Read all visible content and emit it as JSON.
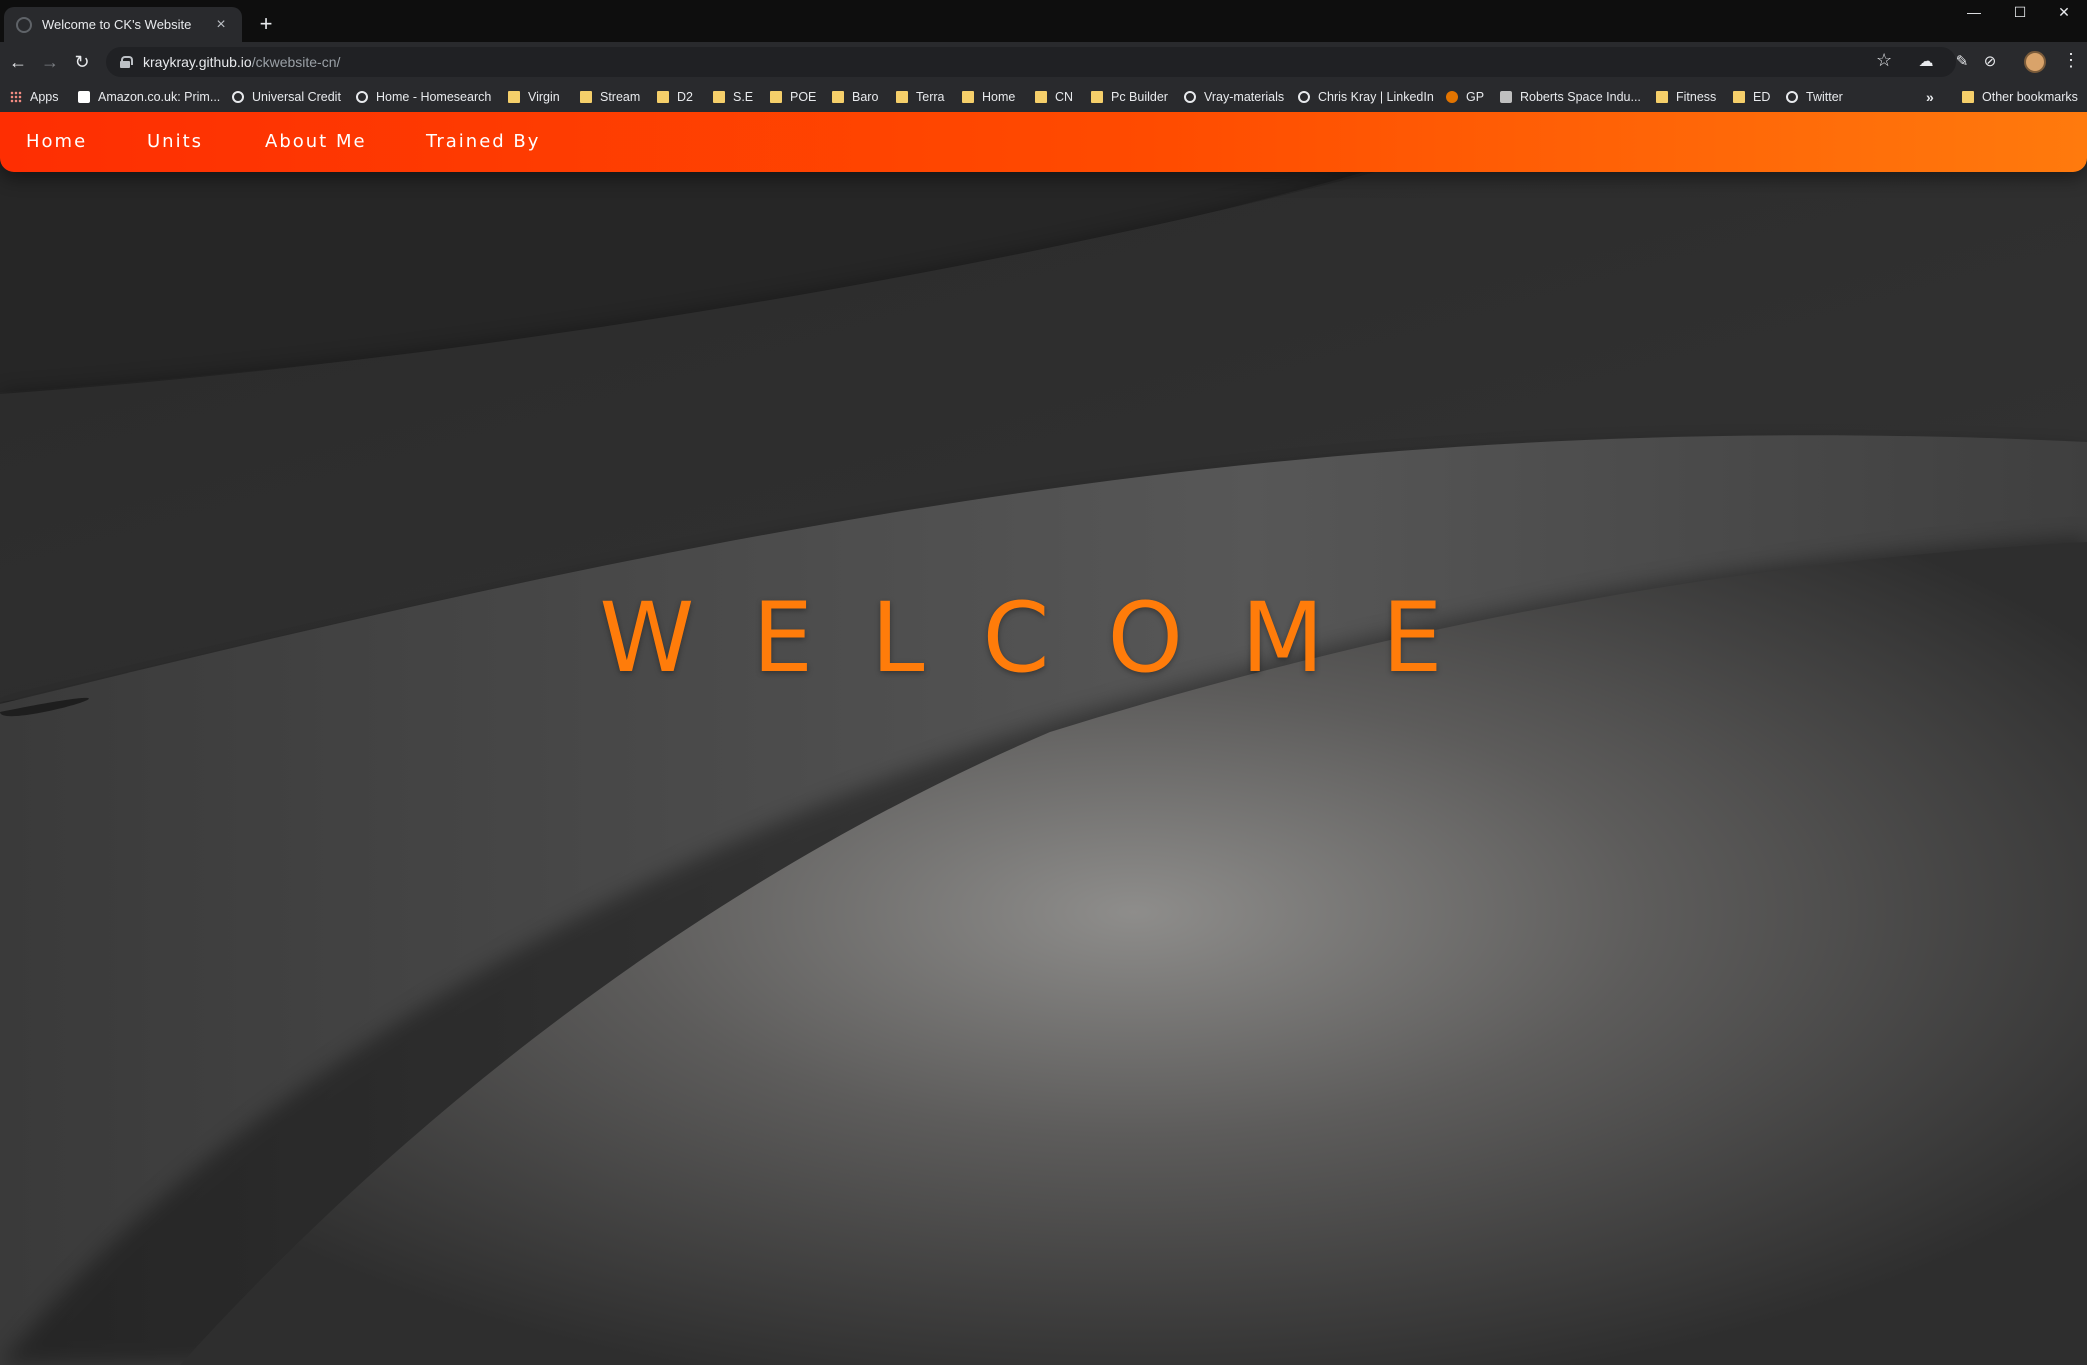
{
  "browser": {
    "tab": {
      "title": "Welcome to CK's Website"
    },
    "new_tab_symbol": "+",
    "window_controls": [
      "—",
      "☐",
      "✕"
    ],
    "url_host": "kraykray.github.io",
    "url_path": "/ckwebsite-cn/",
    "bookmarks": [
      {
        "label": "Apps",
        "icon": "apps-icon"
      },
      {
        "label": "Amazon.co.uk: Prim...",
        "icon": "amazon-icon"
      },
      {
        "label": "Universal Credit",
        "icon": "globe-icon"
      },
      {
        "label": "Home - Homesearch",
        "icon": "globe-icon"
      },
      {
        "label": "Virgin",
        "icon": "folder-icon"
      },
      {
        "label": "Stream",
        "icon": "folder-icon"
      },
      {
        "label": "D2",
        "icon": "folder-icon"
      },
      {
        "label": "S.E",
        "icon": "folder-icon"
      },
      {
        "label": "POE",
        "icon": "folder-icon"
      },
      {
        "label": "Baro",
        "icon": "folder-icon"
      },
      {
        "label": "Terra",
        "icon": "folder-icon"
      },
      {
        "label": "Home",
        "icon": "folder-icon"
      },
      {
        "label": "CN",
        "icon": "folder-icon"
      },
      {
        "label": "Pc Builder",
        "icon": "folder-icon"
      },
      {
        "label": "Vray-materials",
        "icon": "globe-icon"
      },
      {
        "label": "Chris Kray | LinkedIn",
        "icon": "globe-icon"
      },
      {
        "label": "GP",
        "icon": "gp-icon"
      },
      {
        "label": "Roberts Space Indu...",
        "icon": "rsi-icon"
      },
      {
        "label": "Fitness",
        "icon": "folder-icon"
      },
      {
        "label": "ED",
        "icon": "folder-icon"
      },
      {
        "label": "Twitter",
        "icon": "globe-icon"
      }
    ],
    "bookmarks_overflow": "»",
    "other_bookmarks": "Other bookmarks"
  },
  "site": {
    "nav": [
      "Home",
      "Units",
      "About Me",
      "Trained By"
    ],
    "hero_text": "WELCOME",
    "colors": {
      "nav_gradient_start": "#fe2e02",
      "nav_gradient_end": "#ff7a0d",
      "hero_text": "#ff7c0a",
      "background": "#3b3b3b"
    }
  }
}
